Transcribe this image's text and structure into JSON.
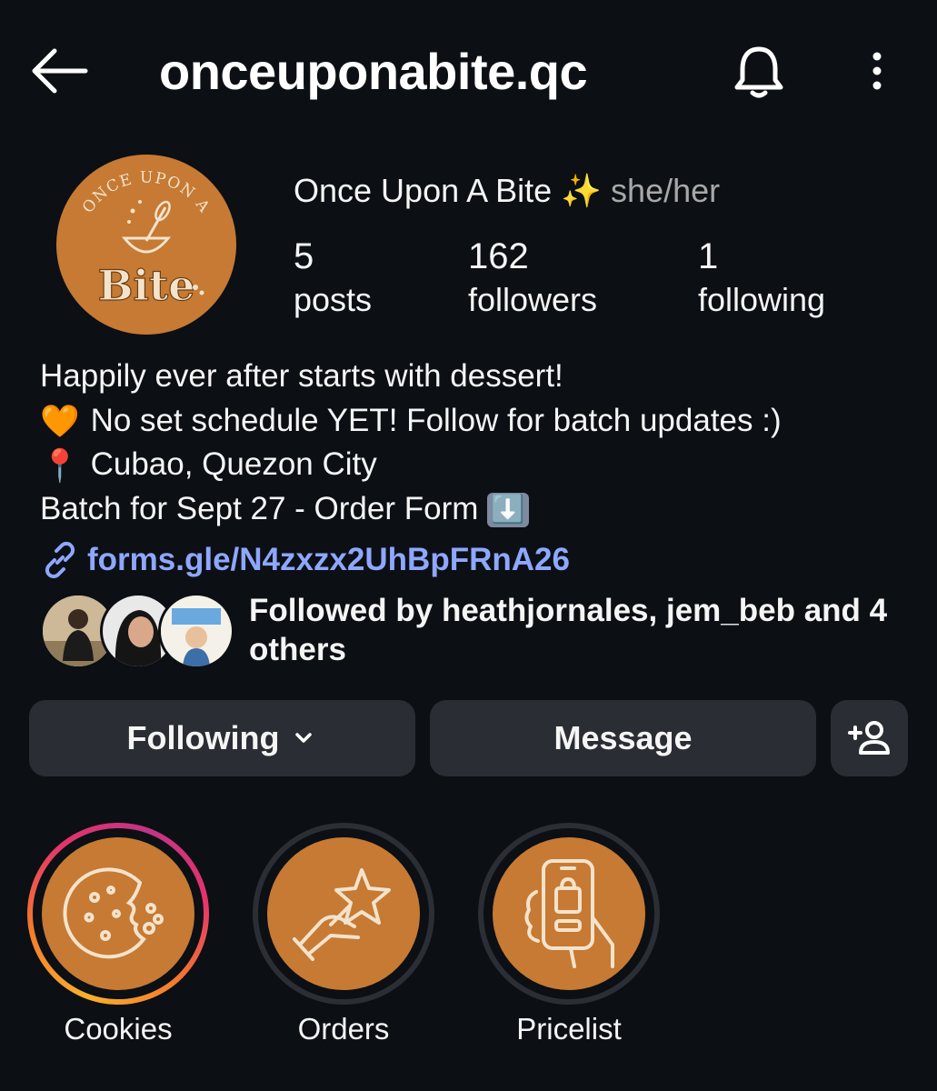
{
  "header": {
    "username": "onceuponabite.qc",
    "back_icon": "arrow-left-icon",
    "bell_icon": "bell-icon",
    "more_icon": "more-vertical-icon"
  },
  "profile": {
    "display_name": "Once Upon A Bite",
    "name_emoji": "✨",
    "pronouns": "she/her",
    "avatar_logo_top": "ONCE UPON A",
    "avatar_logo_bottom": "Bite"
  },
  "stats": [
    {
      "value": "5",
      "label": "posts"
    },
    {
      "value": "162",
      "label": "followers"
    },
    {
      "value": "1",
      "label": "following"
    }
  ],
  "bio": {
    "line1": "Happily ever after starts with dessert!",
    "line2_emoji": "🧡",
    "line2": "No set schedule YET! Follow for batch updates :)",
    "line3_emoji": "📍",
    "line3": "Cubao, Quezon City",
    "line4": "Batch for Sept 27 - Order Form",
    "line4_emoji": "⬇️"
  },
  "link": {
    "icon": "link-icon",
    "text": "forms.gle/N4zxzx2UhBpFRnA26"
  },
  "mutuals": {
    "text": "Followed by heathjornales, jem_beb and 4 others"
  },
  "buttons": {
    "following_label": "Following",
    "message_label": "Message",
    "add_user_icon": "add-person-icon"
  },
  "highlights": [
    {
      "label": "Cookies",
      "icon": "cookie-icon"
    },
    {
      "label": "Orders",
      "icon": "hand-star-icon"
    },
    {
      "label": "Pricelist",
      "icon": "phone-shopping-icon"
    }
  ],
  "colors": {
    "background": "#0c0f14",
    "accent_orange": "#c67a33",
    "link_blue": "#8ea7ff",
    "button_bg": "#2a2d33"
  }
}
